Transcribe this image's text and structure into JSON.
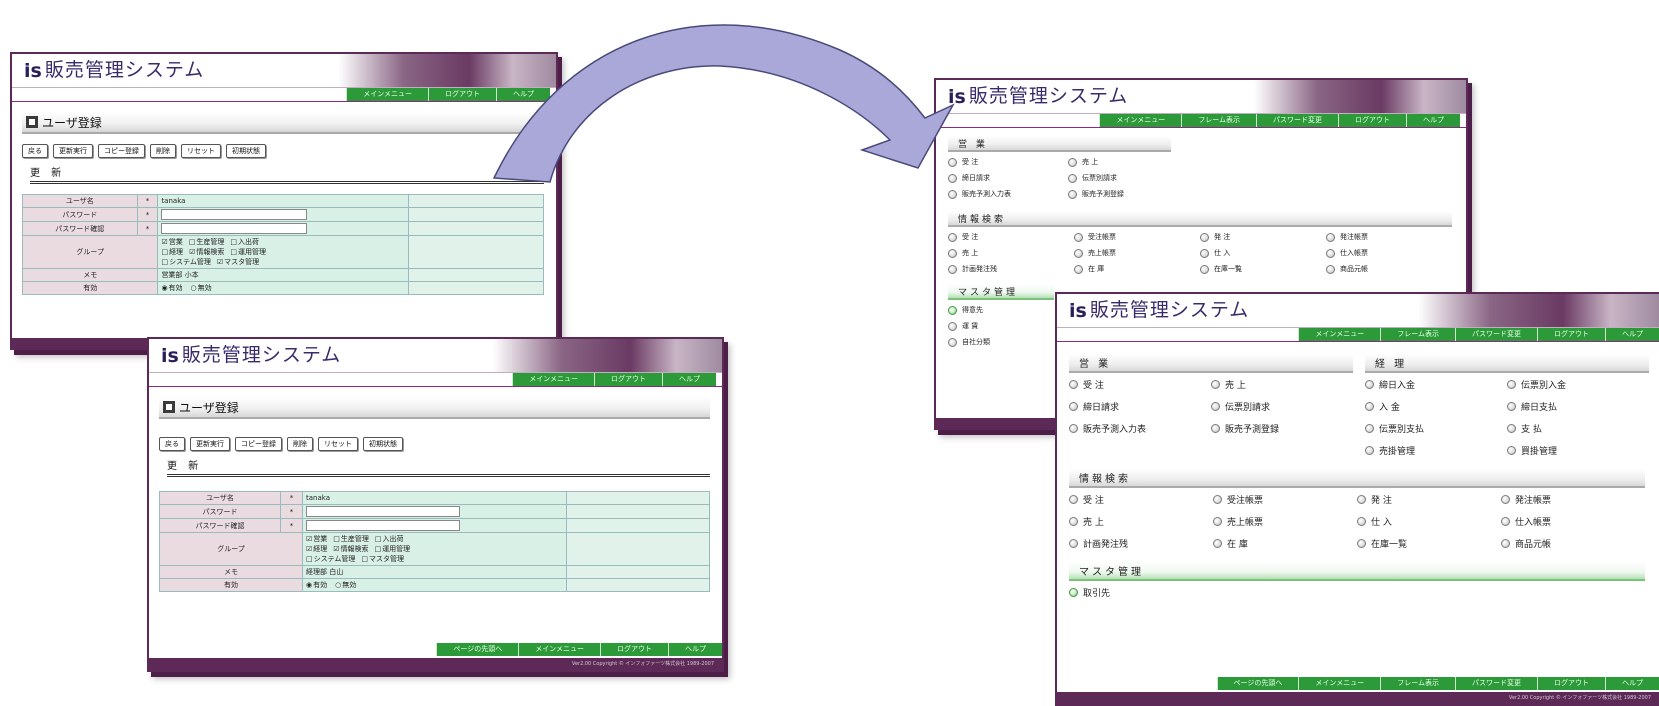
{
  "app": {
    "logo": "is",
    "title": "販売管理システム"
  },
  "nav_top_short": [
    "メインメニュー",
    "ログアウト",
    "ヘルプ"
  ],
  "nav_top_long": [
    "メインメニュー",
    "フレーム表示",
    "パスワード変更",
    "ログアウト",
    "ヘルプ"
  ],
  "nav_bottom_form": [
    "ページの先頭へ",
    "メインメニュー",
    "ログアウト",
    "ヘルプ"
  ],
  "nav_bottom_menu": [
    "ページの先頭へ",
    "メインメニュー",
    "フレーム表示",
    "パスワード変更",
    "ログアウト",
    "ヘルプ"
  ],
  "copyright": "Ver2.00 Copyright © インフォファーツ株式会社 1989-2007",
  "user_form": {
    "title": "ユーザ登録",
    "buttons": [
      "戻る",
      "更新実行",
      "コピー登録",
      "削除",
      "リセット",
      "初期状態"
    ],
    "update_heading": "更 新",
    "labels": {
      "user": "ユーザ名",
      "password": "パスワード",
      "password_confirm": "パスワード確認",
      "group": "グループ",
      "memo": "メモ",
      "valid": "有効"
    },
    "required_mark": "*",
    "user_value": "tanaka",
    "groups_row1": [
      "営業",
      "生産管理",
      "入出荷"
    ],
    "groups_row2": [
      "経理",
      "情報検索",
      "運用管理"
    ],
    "groups_row3": [
      "システム管理",
      "マスタ管理"
    ],
    "memo_value_a": "営業部 小本",
    "memo_value_b": "経理部 白山",
    "valid_options": [
      "有効",
      "無効"
    ]
  },
  "menu_small": {
    "sec1": {
      "title": "営 業",
      "items": [
        "受 注",
        "売 上",
        "締日請求",
        "伝票別請求",
        "販売予測入力表",
        "販売予測登録"
      ]
    },
    "sec2": {
      "title": "情報検索",
      "items": [
        "受 注",
        "受注帳票",
        "発 注",
        "発注帳票",
        "売 上",
        "売上帳票",
        "仕 入",
        "仕入帳票",
        "計画発注残",
        "在 庫",
        "在庫一覧",
        "商品元帳"
      ]
    },
    "sec3": {
      "title": "マスタ管理",
      "items": [
        "得意先",
        "運 賃",
        "自社分類"
      ]
    }
  },
  "menu_large": {
    "sec1": {
      "title": "営 業",
      "items": [
        "受 注",
        "売 上",
        "締日請求",
        "伝票別請求",
        "販売予測入力表",
        "販売予測登録"
      ]
    },
    "sec_keiri": {
      "title": "経 理",
      "items": [
        "締日入金",
        "伝票別入金",
        "入 金",
        "締日支払",
        "伝票別支払",
        "支 払",
        "売掛管理",
        "買掛管理"
      ]
    },
    "sec2": {
      "title": "情報検索",
      "items": [
        "受 注",
        "受注帳票",
        "発 注",
        "発注帳票",
        "売 上",
        "売上帳票",
        "仕 入",
        "仕入帳票",
        "計画発注残",
        "在 庫",
        "在庫一覧",
        "商品元帳"
      ]
    },
    "sec3": {
      "title": "マスタ管理",
      "items": [
        "取引先"
      ]
    }
  },
  "colors": {
    "frame": "#5d2a57",
    "nav_green": "#2d9a3a",
    "label_pink": "#eadbe0",
    "value_mint": "#d8f0e6",
    "arrow_fill": "#a8a8d8"
  }
}
